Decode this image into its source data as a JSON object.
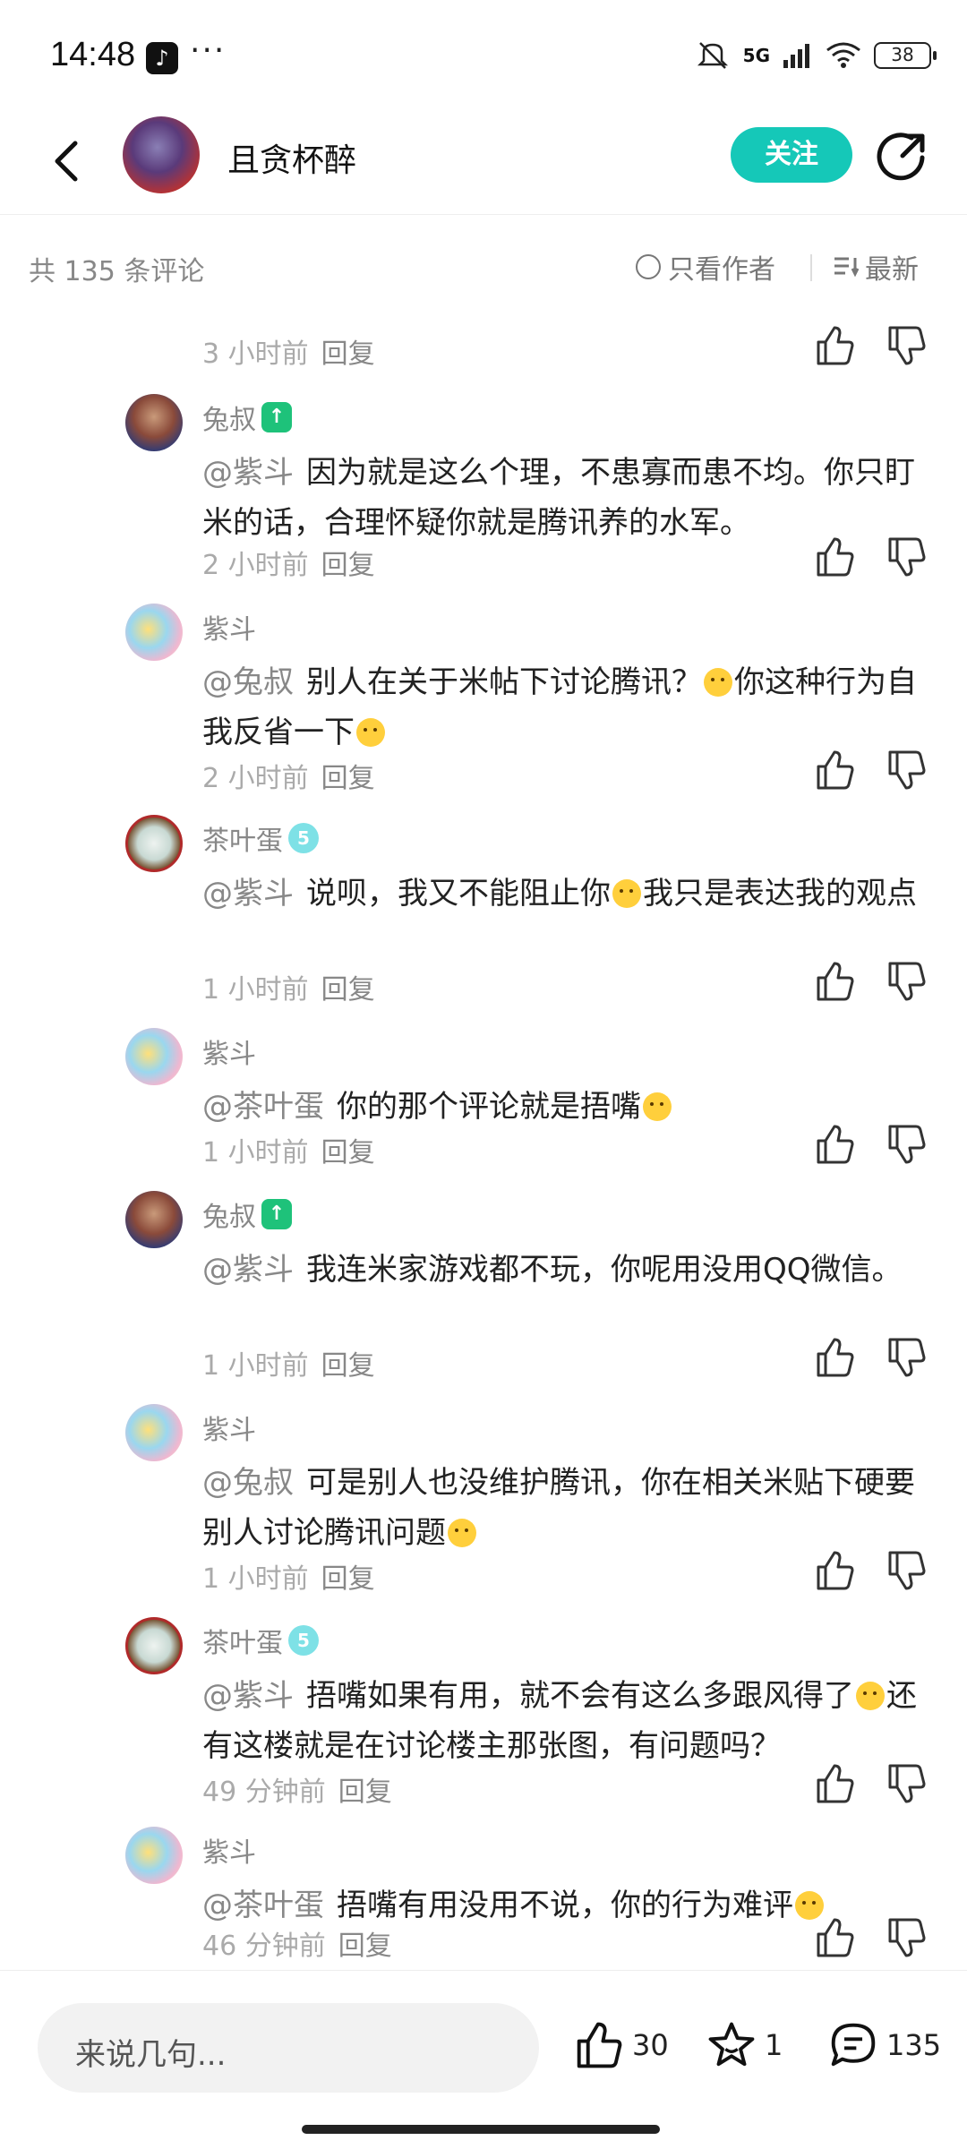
{
  "status_bar": {
    "time": "14:48",
    "app_icon": "tiktok-icon",
    "more": "···",
    "network": "5G",
    "battery": "38"
  },
  "header": {
    "title": "且贪杯醉",
    "follow_label": "关注"
  },
  "comment_bar": {
    "count": "共 135 条评论",
    "only_author": "只看作者",
    "sort": "最新"
  },
  "comments": [
    {
      "time": "3 小时前",
      "reply": "回复"
    },
    {
      "author": "兔叔",
      "badge": "green",
      "mention": "@紫斗",
      "text": "因为就是这么个理，不患寡而患不均。你只盯米的话，合理怀疑你就是腾讯养的水军。",
      "time": "2 小时前",
      "reply": "回复"
    },
    {
      "author": "紫斗",
      "mention": "@兔叔",
      "text_parts": [
        "别人在关于米帖下讨论腾讯？",
        "你这种行为自我反省一下"
      ],
      "time": "2 小时前",
      "reply": "回复"
    },
    {
      "author": "茶叶蛋",
      "badge": "teal",
      "mention": "@紫斗",
      "text_parts": [
        "说呗，我又不能阻止你",
        "我只是表达我的观点"
      ],
      "time": "1 小时前",
      "reply": "回复"
    },
    {
      "author": "紫斗",
      "mention": "@茶叶蛋",
      "text_parts": [
        "你的那个评论就是捂嘴"
      ],
      "time": "1 小时前",
      "reply": "回复"
    },
    {
      "author": "兔叔",
      "badge": "green",
      "mention": "@紫斗",
      "text": "我连米家游戏都不玩，你呢用没用QQ微信。",
      "time": "1 小时前",
      "reply": "回复"
    },
    {
      "author": "紫斗",
      "mention": "@兔叔",
      "text_parts": [
        "可是别人也没维护腾讯，你在相关米贴下硬要别人讨论腾讯问题"
      ],
      "time": "1 小时前",
      "reply": "回复"
    },
    {
      "author": "茶叶蛋",
      "badge": "teal",
      "mention": "@紫斗",
      "text_parts": [
        "捂嘴如果有用，就不会有这么多跟风得了",
        "还有这楼就是在讨论楼主那张图，有问题吗？"
      ],
      "time": "49 分钟前",
      "reply": "回复"
    },
    {
      "author": "紫斗",
      "mention": "@茶叶蛋",
      "text_parts": [
        "捂嘴有用没用不说，你的行为难评"
      ],
      "time": "46 分钟前",
      "reply": "回复"
    }
  ],
  "bottom_bar": {
    "input_placeholder": "来说几句...",
    "likes": "30",
    "favorites": "1",
    "comments": "135"
  }
}
